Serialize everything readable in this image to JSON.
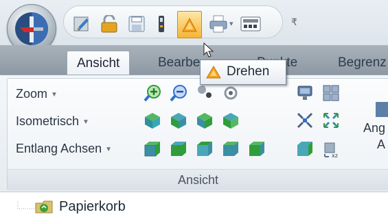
{
  "tabs": [
    {
      "label": "Ansicht",
      "active": true
    },
    {
      "label": "Bearbe"
    },
    {
      "label": "Punkte"
    },
    {
      "label": "Begrenz"
    }
  ],
  "ribbon": {
    "zoom_label": "Zoom",
    "iso_label": "Isometrisch",
    "axes_label": "Entlang Achsen",
    "group_label": "Ansicht",
    "partial_line1": "Ang",
    "partial_line2": "A"
  },
  "tooltip": {
    "label": "Drehen"
  },
  "tree": {
    "item_label": "Papierkorb"
  },
  "colors": {
    "accent": "#f5a31c",
    "green": "#2f9e3a",
    "teal": "#3a8fa5",
    "blue": "#2f6fd0"
  }
}
